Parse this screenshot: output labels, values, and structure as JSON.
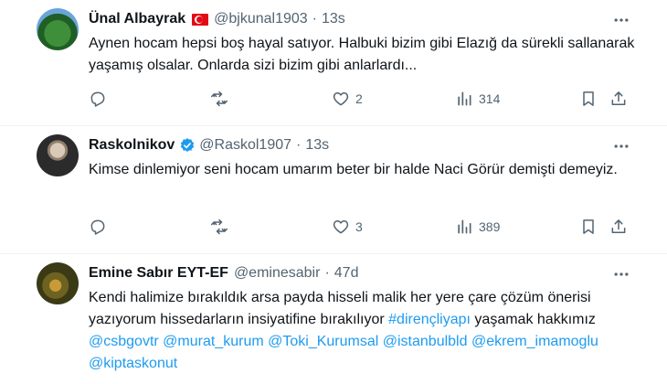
{
  "tweets": [
    {
      "name": "Ünal Albayrak",
      "handle": "@bjkunal1903",
      "time": "13s",
      "text": "Aynen hocam hepsi boş hayal satıyor. Halbuki bizim gibi Elazığ da sürekli sallanarak yaşamış olsalar. Onlarda sizi bizim gibi anlarlardı...",
      "likes": "2",
      "views": "314"
    },
    {
      "name": "Raskolnikov",
      "handle": "@Raskol1907",
      "time": "13s",
      "text": "Kimse dinlemiyor seni hocam umarım beter bir halde Naci Görür demişti demeyiz.",
      "likes": "3",
      "views": "389"
    },
    {
      "name": "Emine Sabır EYT-EF",
      "handle": "@eminesabir",
      "time": "47d",
      "text_part1": "Kendi halimize bırakıldık arsa payda hisseli malik her yere çare çözüm önerisi yazıyorum hissedarların insiyatifine bırakılıyor",
      "hashtag": "#dirençliyapı",
      "text_part2": "yaşamak hakkımız",
      "mentions": [
        "@csbgovtr",
        "@murat_kurum",
        "@Toki_Kurumsal",
        "@istanbulbld",
        "@ekrem_imamoglu",
        "@kiptaskonut"
      ]
    }
  ],
  "separator": "·",
  "colors": {
    "text": "#0f1419",
    "secondary": "#536471",
    "link": "#1d9bf0",
    "flag": "#e30a17",
    "verified": "#1d9bf0"
  }
}
